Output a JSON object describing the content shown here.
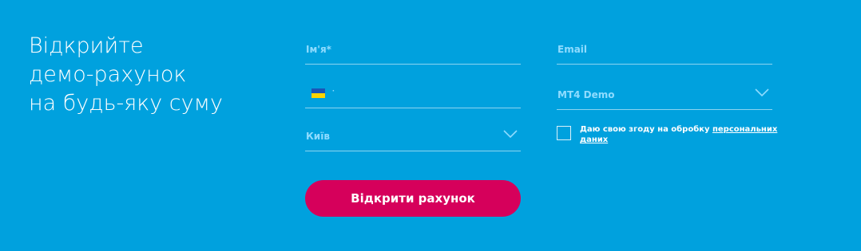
{
  "headline": {
    "line1": "Відкрийте",
    "line2": "демо-рахунок",
    "line3": "на будь-яку суму"
  },
  "form": {
    "name_placeholder": "Ім'я*",
    "email_placeholder": "Email",
    "phone_prefix": "·",
    "account_type_value": "MT4 Demo",
    "city_value": "Київ",
    "consent_text": "Даю свою згоду на обробку",
    "consent_link": "персональних даних",
    "submit_label": "Відкрити рахунок"
  },
  "colors": {
    "background": "#00a1de",
    "button": "#d6005b",
    "placeholder": "#8fdcff"
  },
  "icons": {
    "dropdown": "chevron-down-icon",
    "flag": "ukraine-flag-icon"
  }
}
